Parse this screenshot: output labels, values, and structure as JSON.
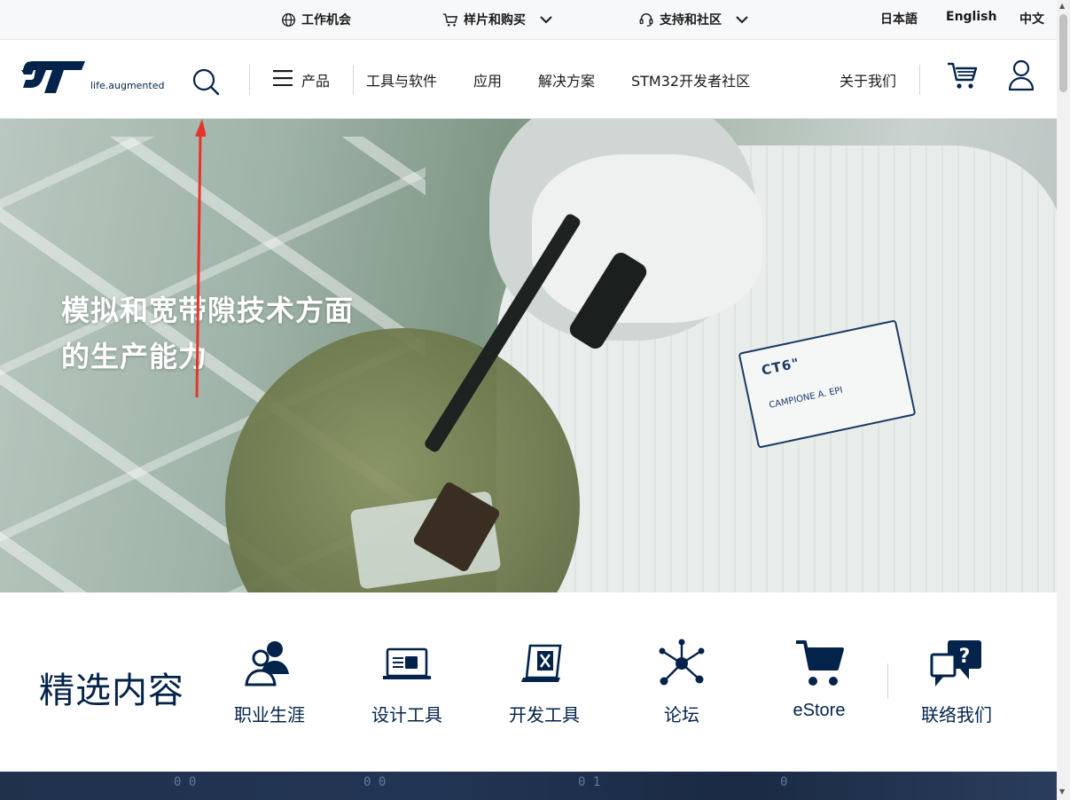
{
  "topbar": {
    "careers": "工作机会",
    "samples": "样片和购买",
    "support": "支持和社区",
    "languages": [
      "日本語",
      "English",
      "中文"
    ]
  },
  "header": {
    "logo_tagline": "life.augmented",
    "nav": [
      "产品",
      "工具与软件",
      "应用",
      "解决方案",
      "STM32开发者社区"
    ],
    "about": "关于我们"
  },
  "hero": {
    "title_line1": "模拟和宽带隙技术方面",
    "title_line2": "的生产能力",
    "badge_text": "CT6\"",
    "badge_sub": "CAMPIONE A. EPI"
  },
  "featured": {
    "title": "精选内容",
    "items": [
      {
        "label": "职业生涯",
        "icon": "career-icon"
      },
      {
        "label": "设计工具",
        "icon": "design-tools-icon"
      },
      {
        "label": "开发工具",
        "icon": "dev-tools-icon"
      },
      {
        "label": "论坛",
        "icon": "forum-icon"
      },
      {
        "label": "eStore",
        "icon": "estore-icon"
      },
      {
        "label": "联络我们",
        "icon": "contact-icon"
      }
    ]
  },
  "colors": {
    "brand_navy": "#03234b",
    "annotation_arrow": "#e8332a"
  }
}
